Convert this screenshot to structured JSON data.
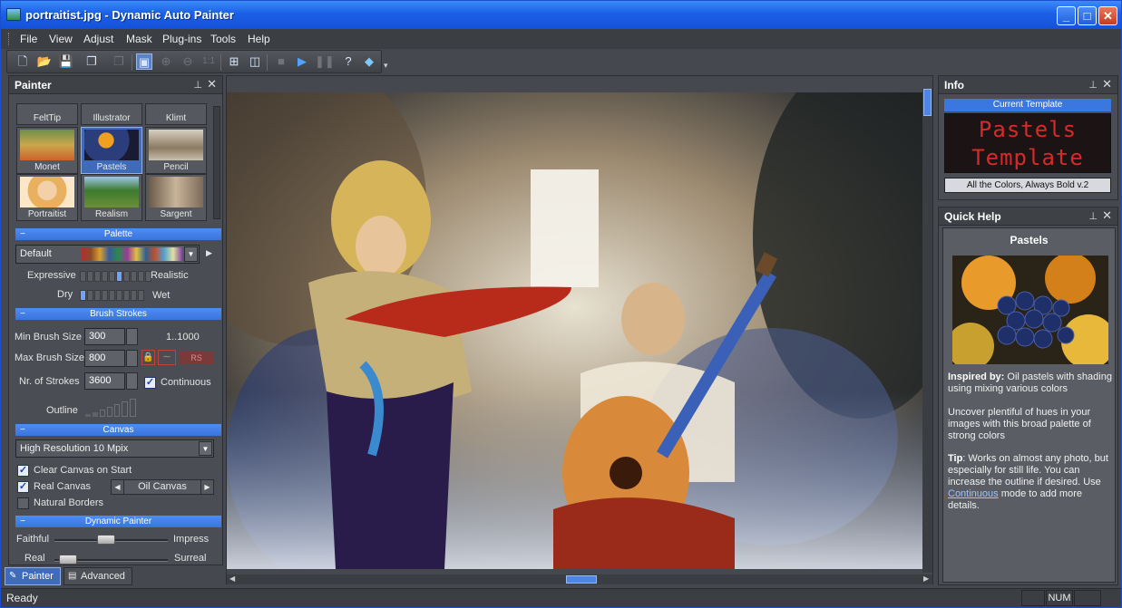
{
  "window": {
    "title": "portraitist.jpg - Dynamic Auto Painter",
    "minimize": "_",
    "maximize": "□",
    "close": "✕"
  },
  "menu": [
    "File",
    "View",
    "Adjust",
    "Mask",
    "Plug-ins",
    "Tools",
    "Help"
  ],
  "toolbar": {
    "icons": [
      "new-icon",
      "open-icon",
      "save-icon",
      "batch-icon",
      "export-icon",
      "photo-icon",
      "zoom-in-icon",
      "zoom-out-icon",
      "zoom-actual-icon",
      "fit-icon",
      "compare-icon",
      "stop-icon",
      "play-icon",
      "pause-icon",
      "help-icon",
      "layers-icon"
    ],
    "zoom_1_1": "1:1"
  },
  "painter_panel": {
    "title": "Painter",
    "top_row": [
      "FeltTip",
      "Illustrator",
      "Klimt"
    ],
    "templates": [
      "Monet",
      "Pastels",
      "Pencil",
      "Portraitist",
      "Realism",
      "Sargent"
    ],
    "selected_template": "Pastels",
    "palette": {
      "header": "Palette",
      "value": "Default",
      "expressive": "Expressive",
      "realistic": "Realistic",
      "dry": "Dry",
      "wet": "Wet",
      "expressive_level": 5,
      "dry_level": 0
    },
    "brush": {
      "header": "Brush Strokes",
      "min_label": "Min Brush Size",
      "min_value": "300",
      "range": "1..1000",
      "max_label": "Max Brush Size",
      "max_value": "800",
      "rs": "RS",
      "strokes_label": "Nr. of Strokes",
      "strokes_value": "3600",
      "continuous": "Continuous",
      "continuous_checked": true,
      "outline": "Outline"
    },
    "canvas": {
      "header": "Canvas",
      "resolution": "High Resolution 10 Mpix",
      "clear": "Clear Canvas on Start",
      "clear_checked": true,
      "real": "Real Canvas",
      "real_checked": true,
      "canvas_type": "Oil Canvas",
      "natural": "Natural Borders",
      "natural_checked": false
    },
    "dynamic": {
      "header": "Dynamic Painter",
      "faithful": "Faithful",
      "impress": "Impress",
      "real": "Real",
      "surreal": "Surreal",
      "faithful_level": 0.45,
      "real_level": 0.05
    },
    "tabs": [
      "Painter",
      "Advanced"
    ]
  },
  "info_panel": {
    "title": "Info",
    "current_template": "Current Template",
    "led_line1": "Pastels",
    "led_line2": "Template",
    "template_name": "All the Colors, Always Bold v.2"
  },
  "help_panel": {
    "title": "Quick Help",
    "heading": "Pastels",
    "inspired_label": "Inspired by:",
    "inspired_text": " Oil pastels with shading using mixing various colors",
    "para2": "Uncover plentiful of hues in your images with this broad palette of strong colors",
    "tip_label": "Tip",
    "tip_text": ": Works on almost any photo, but especially for still life. You can increase the outline if desired. Use ",
    "tip_link": "Continuous",
    "tip_end": " mode to add more details."
  },
  "status": {
    "text": "Ready",
    "num": "NUM"
  }
}
